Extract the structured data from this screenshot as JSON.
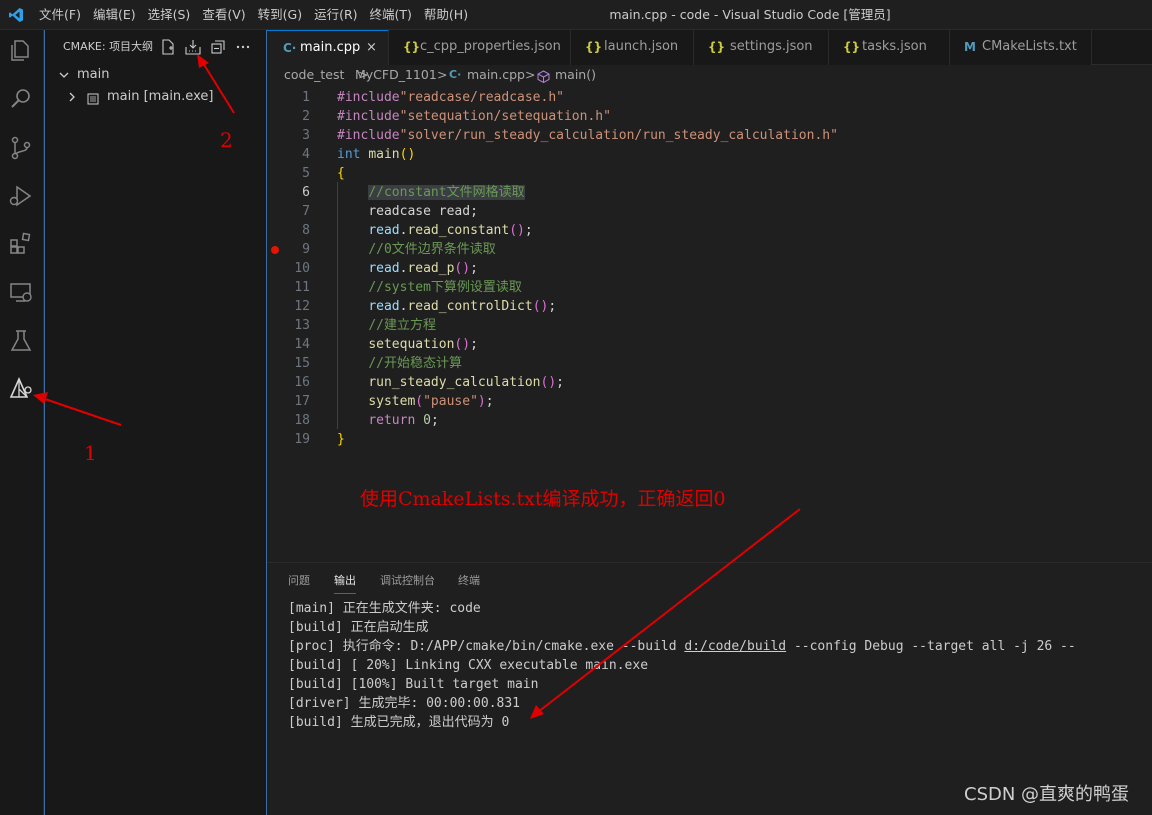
{
  "menu": {
    "items": [
      "文件(F)",
      "编辑(E)",
      "选择(S)",
      "查看(V)",
      "转到(G)",
      "运行(R)",
      "终端(T)",
      "帮助(H)"
    ],
    "window_title": "main.cpp - code - Visual Studio Code [管理员]"
  },
  "activity_bar": {
    "icons": [
      "explorer-icon",
      "search-icon",
      "source-control-icon",
      "run-debug-icon",
      "extensions-icon",
      "remote-explorer-icon",
      "testing-icon",
      "cmake-icon"
    ]
  },
  "sidebar": {
    "title": "CMAKE: 项目大纲",
    "tree": [
      {
        "label": "main",
        "expanded": true
      },
      {
        "label": "main [main.exe]",
        "expanded": false
      }
    ]
  },
  "tabs": [
    {
      "label": "main.cpp",
      "icon_text": "C·",
      "icon_color": "#519aba",
      "active": true,
      "close": "×"
    },
    {
      "label": "c_cpp_properties.json",
      "icon_text": "{}",
      "icon_color": "#cbcb41",
      "active": false
    },
    {
      "label": "launch.json",
      "icon_text": "{}",
      "icon_color": "#cbcb41",
      "active": false
    },
    {
      "label": "settings.json",
      "icon_text": "{}",
      "icon_color": "#cbcb41",
      "active": false
    },
    {
      "label": "tasks.json",
      "icon_text": "{}",
      "icon_color": "#cbcb41",
      "active": false
    },
    {
      "label": "CMakeLists.txt",
      "icon_text": "M",
      "icon_color": "#519aba",
      "active": false
    }
  ],
  "breadcrumb": {
    "items": [
      "code_test",
      "MyCFD_1101",
      "main.cpp",
      "main()"
    ],
    "separator": ">"
  },
  "editor": {
    "line_numbers": [
      "1",
      "2",
      "3",
      "4",
      "5",
      "6",
      "7",
      "8",
      "9",
      "10",
      "11",
      "12",
      "13",
      "14",
      "15",
      "16",
      "17",
      "18",
      "19"
    ],
    "current_line": 6,
    "breakpoint_line": 9,
    "lines": [
      [
        [
          "#include",
          "pp"
        ],
        [
          "\"readcase/readcase.h\"",
          "str"
        ]
      ],
      [
        [
          "#include",
          "pp"
        ],
        [
          "\"setequation/setequation.h\"",
          "str"
        ]
      ],
      [
        [
          "#include",
          "pp"
        ],
        [
          "\"solver/run_steady_calculation/run_steady_calculation.h\"",
          "str"
        ]
      ],
      [
        [
          "int",
          "kw"
        ],
        [
          " ",
          "plain"
        ],
        [
          "main",
          "fn"
        ],
        [
          "()",
          "br1"
        ]
      ],
      [
        [
          "{",
          "br1"
        ]
      ],
      [
        [
          "    ",
          "plain"
        ],
        [
          "//constant文件网格读取",
          "cm"
        ]
      ],
      [
        [
          "    ",
          "plain"
        ],
        [
          "readcase",
          "plain"
        ],
        [
          " read;",
          "plain"
        ]
      ],
      [
        [
          "    ",
          "plain"
        ],
        [
          "read",
          "var"
        ],
        [
          ".",
          "plain"
        ],
        [
          "read_constant",
          "fn"
        ],
        [
          "()",
          "br2"
        ],
        [
          ";",
          "plain"
        ]
      ],
      [
        [
          "    ",
          "plain"
        ],
        [
          "//0文件边界条件读取",
          "cm"
        ]
      ],
      [
        [
          "    ",
          "plain"
        ],
        [
          "read",
          "var"
        ],
        [
          ".",
          "plain"
        ],
        [
          "read_p",
          "fn"
        ],
        [
          "()",
          "br2"
        ],
        [
          ";",
          "plain"
        ]
      ],
      [
        [
          "    ",
          "plain"
        ],
        [
          "//system下算例设置读取",
          "cm"
        ]
      ],
      [
        [
          "    ",
          "plain"
        ],
        [
          "read",
          "var"
        ],
        [
          ".",
          "plain"
        ],
        [
          "read_controlDict",
          "fn"
        ],
        [
          "()",
          "br2"
        ],
        [
          ";",
          "plain"
        ]
      ],
      [
        [
          "    ",
          "plain"
        ],
        [
          "//建立方程",
          "cm"
        ]
      ],
      [
        [
          "    ",
          "plain"
        ],
        [
          "setequation",
          "fn"
        ],
        [
          "()",
          "br2"
        ],
        [
          ";",
          "plain"
        ]
      ],
      [
        [
          "    ",
          "plain"
        ],
        [
          "//开始稳态计算",
          "cm"
        ]
      ],
      [
        [
          "    ",
          "plain"
        ],
        [
          "run_steady_calculation",
          "fn"
        ],
        [
          "()",
          "br2"
        ],
        [
          ";",
          "plain"
        ]
      ],
      [
        [
          "    ",
          "plain"
        ],
        [
          "system",
          "fn"
        ],
        [
          "(",
          "br2"
        ],
        [
          "\"pause\"",
          "str"
        ],
        [
          ")",
          "br2"
        ],
        [
          ";",
          "plain"
        ]
      ],
      [
        [
          "    ",
          "plain"
        ],
        [
          "return",
          "ret"
        ],
        [
          " ",
          "plain"
        ],
        [
          "0",
          "num"
        ],
        [
          ";",
          "plain"
        ]
      ],
      [
        [
          "}",
          "br1"
        ]
      ]
    ]
  },
  "annotation": {
    "text": "使用CmakeLists.txt编译成功，正确返回0",
    "label_1": "1",
    "label_2": "2",
    "color": "#e00000"
  },
  "panel": {
    "tabs": [
      {
        "label": "问题",
        "active": false
      },
      {
        "label": "输出",
        "active": true
      },
      {
        "label": "调试控制台",
        "active": false
      },
      {
        "label": "终端",
        "active": false
      }
    ],
    "output": [
      "[main] 正在生成文件夹: code",
      "[build] 正在启动生成",
      "[proc] 执行命令: D:/APP/cmake/bin/cmake.exe --build d:/code/build --config Debug --target all -j 26 --",
      "[build] [ 20%] Linking CXX executable main.exe",
      "[build] [100%] Built target main",
      "[driver] 生成完毕: 00:00:00.831",
      "[build] 生成已完成，退出代码为 0"
    ]
  },
  "watermark": "CSDN @直爽的鸭蛋",
  "colors": {
    "accent": "#0078d4",
    "breakpoint": "#e51400",
    "annotation_red": "#e00000"
  }
}
